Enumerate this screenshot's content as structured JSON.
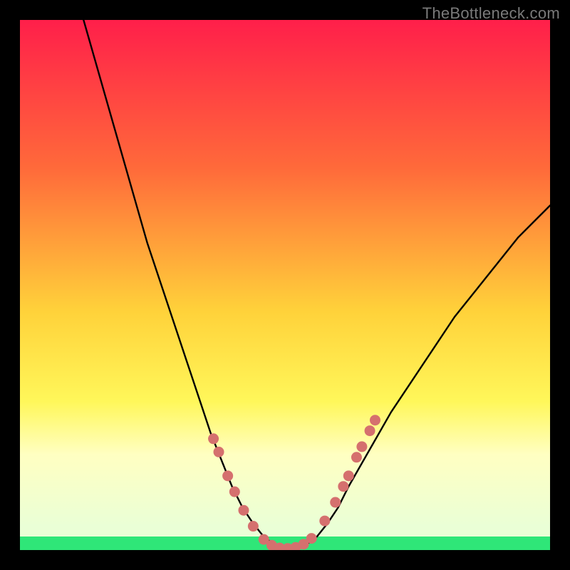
{
  "watermark": "TheBottleneck.com",
  "colors": {
    "black": "#000000",
    "curve": "#000000",
    "dot": "#d5706e",
    "green": "#2fe678",
    "grad_top": "#ff1f4a",
    "grad_mid1": "#ff6a3a",
    "grad_mid2": "#ffd23a",
    "grad_mid3": "#fff75a",
    "grad_light": "#ffffc2",
    "grad_pale": "#eaffd6"
  },
  "chart_data": {
    "type": "line",
    "title": "",
    "xlabel": "",
    "ylabel": "",
    "xlim": [
      0,
      100
    ],
    "ylim": [
      0,
      100
    ],
    "series": [
      {
        "name": "bottleneck-curve",
        "x": [
          12,
          14,
          16,
          18,
          20,
          22,
          24,
          26,
          28,
          30,
          32,
          34,
          35,
          36,
          38,
          40,
          42,
          44,
          46,
          48,
          50,
          52,
          54,
          56,
          58,
          60,
          62,
          66,
          70,
          74,
          78,
          82,
          86,
          90,
          94,
          98,
          100
        ],
        "y": [
          100,
          93,
          86,
          79,
          72,
          65,
          58,
          52,
          46,
          40,
          34,
          28,
          25,
          22,
          17,
          12,
          8,
          5,
          2.5,
          1,
          0.3,
          0.3,
          1,
          2.5,
          5,
          8,
          12,
          19,
          26,
          32,
          38,
          44,
          49,
          54,
          59,
          63,
          65
        ]
      }
    ],
    "dots": {
      "name": "highlighted-points",
      "points": [
        {
          "x": 36.5,
          "y": 21
        },
        {
          "x": 37.5,
          "y": 18.5
        },
        {
          "x": 39.2,
          "y": 14
        },
        {
          "x": 40.5,
          "y": 11
        },
        {
          "x": 42.2,
          "y": 7.5
        },
        {
          "x": 44.0,
          "y": 4.5
        },
        {
          "x": 46.0,
          "y": 2.0
        },
        {
          "x": 47.5,
          "y": 0.9
        },
        {
          "x": 49.0,
          "y": 0.4
        },
        {
          "x": 50.5,
          "y": 0.3
        },
        {
          "x": 52.0,
          "y": 0.5
        },
        {
          "x": 53.5,
          "y": 1.1
        },
        {
          "x": 55.0,
          "y": 2.2
        },
        {
          "x": 57.5,
          "y": 5.5
        },
        {
          "x": 59.5,
          "y": 9.0
        },
        {
          "x": 61.0,
          "y": 12.0
        },
        {
          "x": 62.0,
          "y": 14.0
        },
        {
          "x": 63.5,
          "y": 17.5
        },
        {
          "x": 64.5,
          "y": 19.5
        },
        {
          "x": 66.0,
          "y": 22.5
        },
        {
          "x": 67.0,
          "y": 24.5
        }
      ]
    },
    "green_band": {
      "y0": 0,
      "y1": 2.5
    },
    "pale_band_top": 18
  }
}
